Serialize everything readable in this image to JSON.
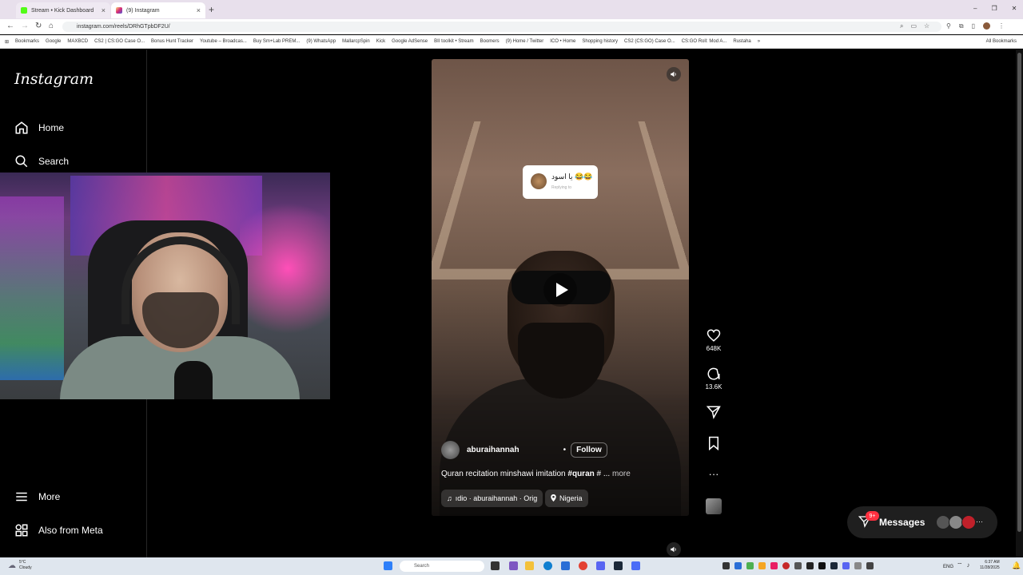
{
  "browser": {
    "tabs": [
      {
        "title": "Stream • Kick Dashboard",
        "color": "#53fc18"
      },
      {
        "title": "(9) Instagram",
        "color": "#e1306c"
      }
    ],
    "new_tab": "+",
    "url": "instagram.com/reels/DRhGTpbDF2U/",
    "window_controls": [
      "–",
      "❐",
      "✕"
    ],
    "bookmarks": [
      "Bookmarks",
      "Google",
      "MAXBCD",
      "CS2 | CS:GO Case O...",
      "Bonus Hunt Tracker",
      "Youtube – Broadcas...",
      "Buy Sm+Lab PREM...",
      "(9) WhatsApp",
      "MallarcpSpin",
      "Kick",
      "Google AdSense",
      "BII toolkit • Stream",
      "Boomers",
      "(9) Home / Twitter",
      "ICO • Home",
      "Shopping history",
      "CS2 (CS:GO) Case O...",
      "CS:GO Roll: Mod A...",
      "Rustaha"
    ],
    "all_bookmarks": "All Bookmarks"
  },
  "sidebar": {
    "logo": "Instagram",
    "items": [
      {
        "label": "Home",
        "icon": "home-icon"
      },
      {
        "label": "Search",
        "icon": "search-icon"
      }
    ],
    "bottom_items": [
      {
        "label": "More",
        "icon": "menu-icon"
      },
      {
        "label": "Also from Meta",
        "icon": "meta-grid-icon"
      }
    ]
  },
  "reel": {
    "comment_text": "يا اسود 😂😂",
    "comment_sub": "Replying to",
    "author": "aburaihannah",
    "dot": "•",
    "follow": "Follow",
    "caption_prefix": "Quran recitation minshawi imitation ",
    "caption_tag": "#quran",
    "caption_suffix": " # ... ",
    "caption_more": "more",
    "audio": "ıdio · aburaihannah · Orig",
    "location": "Nigeria"
  },
  "actions": {
    "likes": "648K",
    "comments": "13.6K"
  },
  "messages": {
    "label": "Messages",
    "badge": "9+",
    "more": "···"
  },
  "taskbar": {
    "weather_temp": "5°C",
    "weather_desc": "Cloudy",
    "search": "Search",
    "lang": "ENG",
    "time": "6:37 AM",
    "date": "11/28/2025"
  }
}
